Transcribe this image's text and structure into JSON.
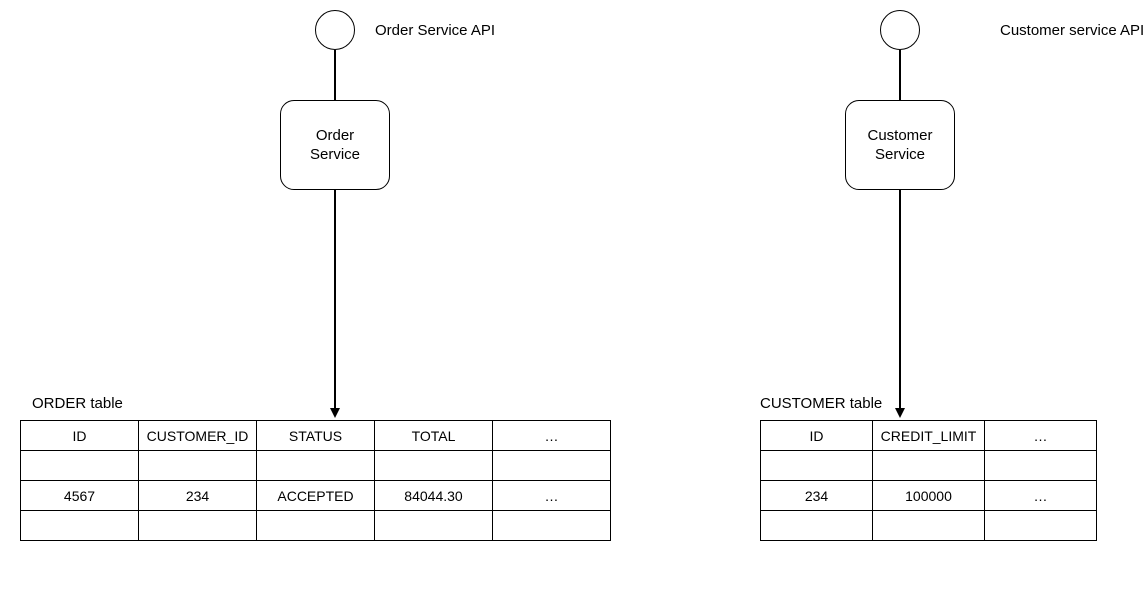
{
  "left": {
    "api_label": "Order Service API",
    "service_label": "Order\nService",
    "table_label": "ORDER table",
    "headers": [
      "ID",
      "CUSTOMER_ID",
      "STATUS",
      "TOTAL",
      "…"
    ],
    "rows": [
      [
        "",
        "",
        "",
        "",
        ""
      ],
      [
        "4567",
        "234",
        "ACCEPTED",
        "84044.30",
        "…"
      ],
      [
        "",
        "",
        "",
        "",
        ""
      ]
    ]
  },
  "right": {
    "api_label": "Customer service API",
    "service_label": "Customer\nService",
    "table_label": "CUSTOMER table",
    "headers": [
      "ID",
      "CREDIT_LIMIT",
      "…"
    ],
    "rows": [
      [
        "",
        "",
        ""
      ],
      [
        "234",
        "100000",
        "…"
      ],
      [
        "",
        "",
        ""
      ]
    ]
  }
}
